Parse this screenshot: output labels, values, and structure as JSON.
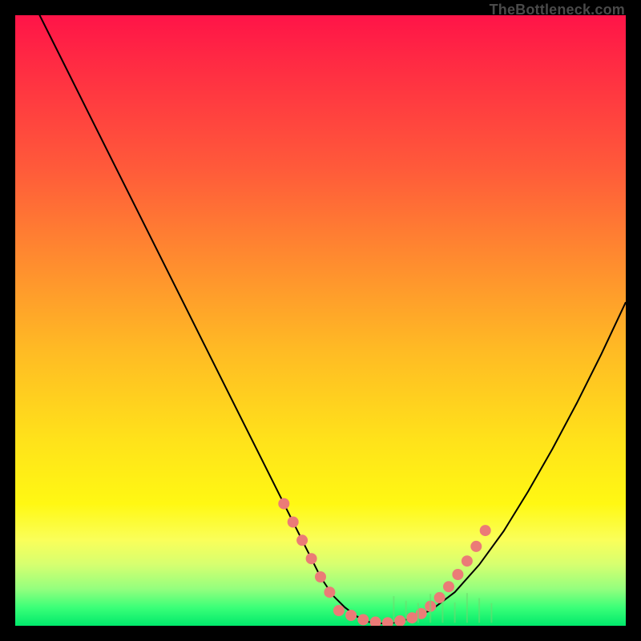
{
  "watermark": "TheBottleneck.com",
  "chart_data": {
    "type": "line",
    "title": "",
    "xlabel": "",
    "ylabel": "",
    "xlim": [
      0,
      100
    ],
    "ylim": [
      0,
      100
    ],
    "series": [
      {
        "name": "bottleneck-curve",
        "x": [
          0,
          4,
          8,
          12,
          16,
          20,
          24,
          28,
          32,
          36,
          40,
          44,
          48,
          50,
          52,
          54,
          56,
          58,
          60,
          62,
          64,
          68,
          72,
          76,
          80,
          84,
          88,
          92,
          96,
          100
        ],
        "values": [
          108,
          100,
          92,
          84,
          76,
          68,
          60,
          52,
          44,
          36,
          28,
          20,
          12,
          8,
          5,
          3,
          1.5,
          0.6,
          0.4,
          0.5,
          1,
          2.5,
          5.5,
          10,
          15.5,
          22,
          29,
          36.5,
          44.5,
          53
        ]
      }
    ],
    "highlight_points": {
      "name": "optimal-range-dots",
      "left_cluster_x": [
        44,
        45.5,
        47,
        48.5,
        50,
        51.5
      ],
      "left_cluster_y": [
        20,
        17,
        14,
        11,
        8,
        5.5
      ],
      "bottom_cluster_x": [
        53,
        55,
        57,
        59,
        61,
        63,
        65
      ],
      "bottom_cluster_y": [
        2.5,
        1.7,
        1.0,
        0.6,
        0.5,
        0.8,
        1.3
      ],
      "right_cluster_x": [
        66.5,
        68,
        69.5,
        71,
        72.5,
        74,
        75.5,
        77
      ],
      "right_cluster_y": [
        2.0,
        3.2,
        4.6,
        6.4,
        8.4,
        10.6,
        13.0,
        15.6
      ]
    },
    "colors": {
      "curve": "#000000",
      "dots": "#eb7b77",
      "gradient_top": "#ff1448",
      "gradient_bottom": "#00e96b"
    }
  }
}
